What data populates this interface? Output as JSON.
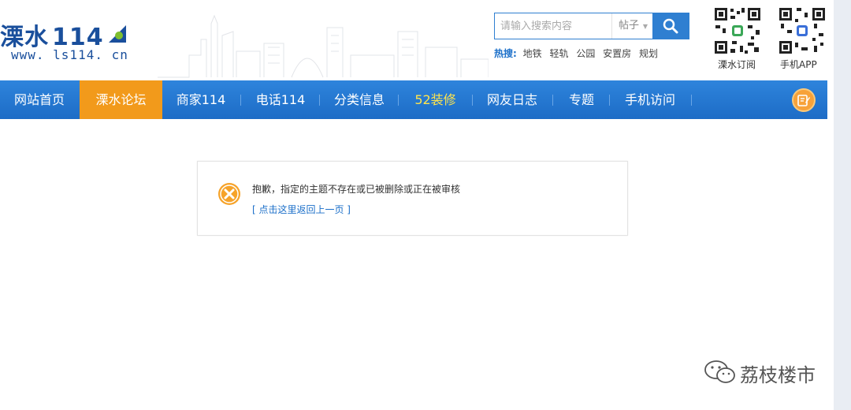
{
  "header": {
    "logo_text": "溧水",
    "logo_number": "114",
    "logo_url": "www. ls114. cn",
    "search": {
      "placeholder": "请输入搜索内容",
      "type_label": "帖子",
      "button_icon": "search-icon"
    },
    "hot_search": {
      "label": "热搜:",
      "items": [
        "地铁",
        "轻轨",
        "公园",
        "安置房",
        "规划"
      ]
    },
    "qr_codes": [
      {
        "label": "溧水订阅"
      },
      {
        "label": "手机APP"
      }
    ]
  },
  "nav": {
    "items": [
      {
        "label": "网站首页"
      },
      {
        "label": "溧水论坛"
      },
      {
        "label": "商家114"
      },
      {
        "label": "电话114"
      },
      {
        "label": "分类信息"
      },
      {
        "label": "52装修"
      },
      {
        "label": "网友日志"
      },
      {
        "label": "专题"
      },
      {
        "label": "手机访问"
      }
    ],
    "active_index": 1,
    "highlight_index": 5,
    "edit_icon": "edit-icon"
  },
  "message": {
    "icon": "error-x-icon",
    "text": "抱歉，指定的主题不存在或已被删除或正在被审核",
    "back_link": "[ 点击这里返回上一页 ]"
  },
  "watermark": {
    "icon": "wechat-icon",
    "text": "荔枝楼市"
  },
  "colors": {
    "nav_blue": "#1d6cc6",
    "active_orange": "#f29a1b",
    "highlight_yellow": "#ffe44d",
    "link_blue": "#1b6fc9"
  }
}
